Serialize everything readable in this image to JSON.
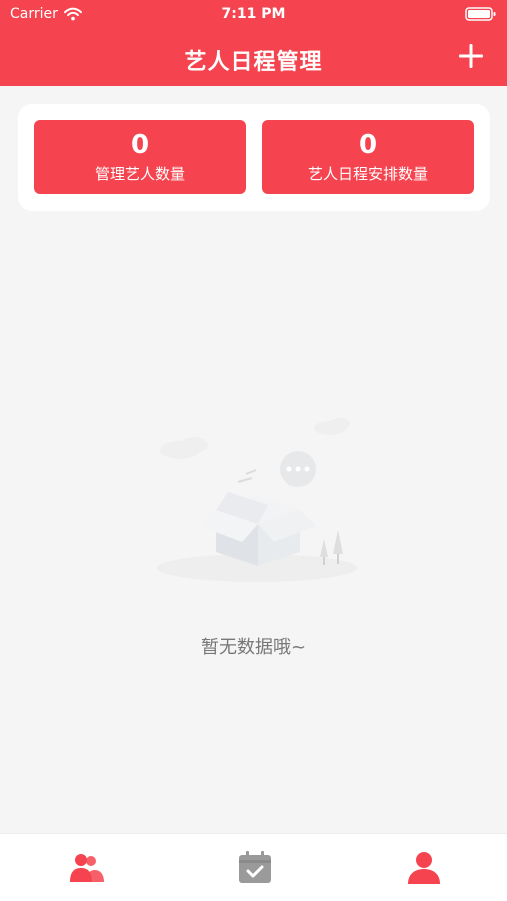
{
  "status_bar": {
    "carrier": "Carrier",
    "time": "7:11 PM"
  },
  "header": {
    "title": "艺人日程管理",
    "add_icon": "plus-icon",
    "color": "#f5444f"
  },
  "stats": {
    "artists_count": "0",
    "artists_label": "管理艺人数量",
    "schedules_count": "0",
    "schedules_label": "艺人日程安排数量"
  },
  "empty_state": {
    "text": "暂无数据哦~",
    "icon": "empty-box-illustration"
  },
  "tabbar": {
    "items": [
      {
        "icon": "artists-icon",
        "active": true,
        "color": "#f5444f"
      },
      {
        "icon": "calendar-icon",
        "active": false,
        "color": "#9a9a9a"
      },
      {
        "icon": "profile-icon",
        "active": false,
        "color": "#f5444f"
      }
    ]
  }
}
